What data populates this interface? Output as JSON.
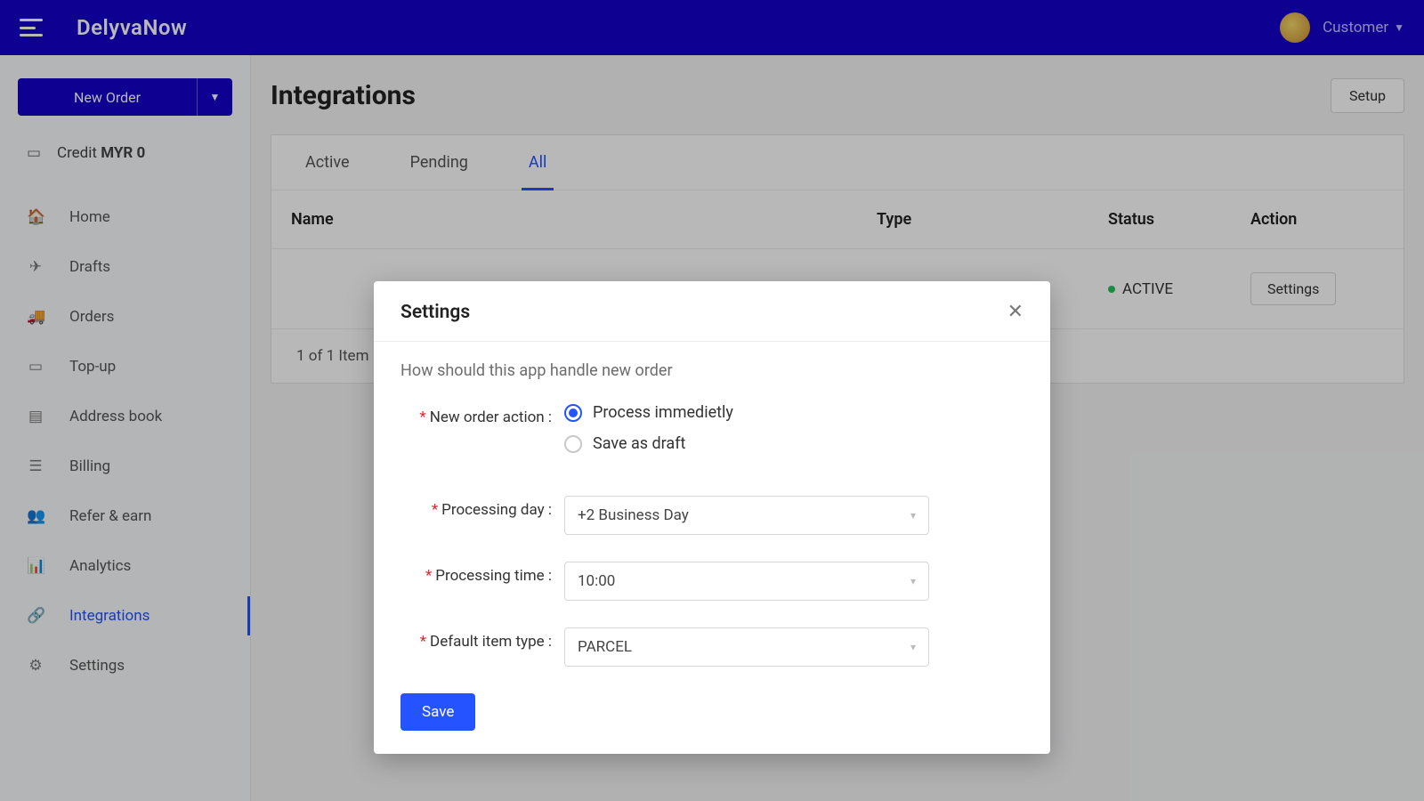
{
  "brand": "DelyvaNow",
  "user": {
    "label": "Customer"
  },
  "sidebar": {
    "new_order": "New Order",
    "credit_label": "Credit",
    "credit_value": "MYR 0",
    "items": [
      {
        "label": "Home",
        "icon": "🏠"
      },
      {
        "label": "Drafts",
        "icon": "✈"
      },
      {
        "label": "Orders",
        "icon": "🚚"
      },
      {
        "label": "Top-up",
        "icon": "▭"
      },
      {
        "label": "Address book",
        "icon": "▤"
      },
      {
        "label": "Billing",
        "icon": "☰"
      },
      {
        "label": "Refer & earn",
        "icon": "👥"
      },
      {
        "label": "Analytics",
        "icon": "📊"
      },
      {
        "label": "Integrations",
        "icon": "🔗"
      },
      {
        "label": "Settings",
        "icon": "⚙"
      }
    ]
  },
  "page": {
    "title": "Integrations",
    "setup": "Setup",
    "tabs": [
      "Active",
      "Pending",
      "All"
    ],
    "columns": {
      "name": "Name",
      "type": "Type",
      "status": "Status",
      "action": "Action"
    },
    "row": {
      "status": "ACTIVE",
      "action": "Settings"
    },
    "footer": "1 of 1 Item"
  },
  "modal": {
    "title": "Settings",
    "description": "How should this app handle new order",
    "labels": {
      "new_order_action": "New order action",
      "processing_day": "Processing day",
      "processing_time": "Processing time",
      "default_item_type": "Default item type"
    },
    "options": {
      "process_now": "Process immedietly",
      "save_draft": "Save as draft"
    },
    "values": {
      "processing_day": "+2 Business Day",
      "processing_time": "10:00",
      "default_item_type": "PARCEL"
    },
    "save": "Save"
  }
}
